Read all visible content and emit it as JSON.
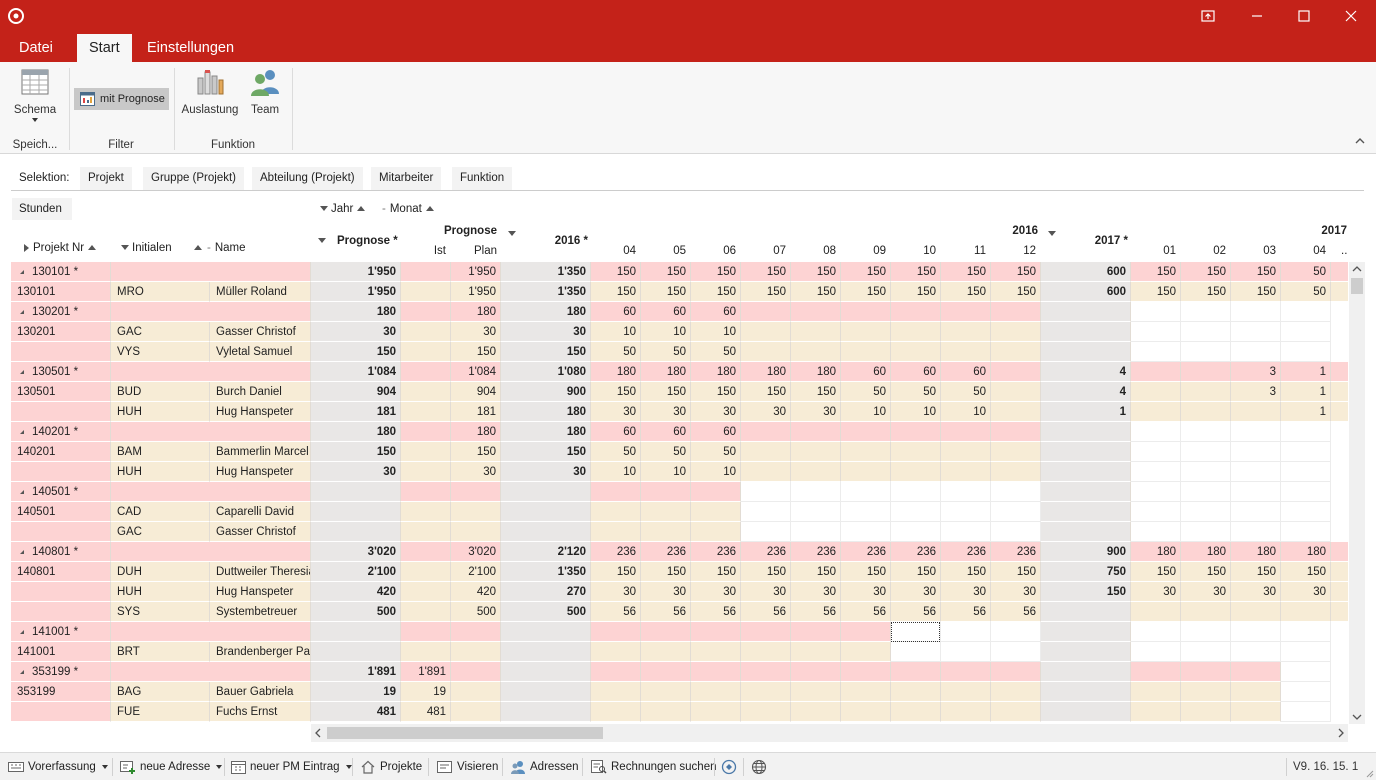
{
  "ribbon": {
    "tabs": [
      "Datei",
      "Start",
      "Einstellungen"
    ],
    "schema_label": "Schema",
    "speich_label": "Speich...",
    "filter_label": "Filter",
    "mit_prognose_label": "mit Prognose",
    "auslastung_label": "Auslastung",
    "team_label": "Team",
    "funktion_label": "Funktion"
  },
  "selection": {
    "label": "Selektion:",
    "items": [
      "Projekt",
      "Gruppe (Projekt)",
      "Abteilung (Projekt)",
      "Mitarbeiter",
      "Funktion"
    ]
  },
  "grid": {
    "data_area": "Stunden",
    "col_dims": [
      "Jahr",
      "Monat"
    ],
    "row_dims": [
      "Projekt Nr",
      "Initialen",
      "Name"
    ],
    "headers": {
      "prognose_star": "Prognose *",
      "prognose": "Prognose",
      "ist": "Ist",
      "plan": "Plan",
      "y2016_total": "2016 *",
      "y2016": "2016",
      "y2017_total": "2017 *",
      "y2017": "2017",
      "months_2016": [
        "04",
        "05",
        "06",
        "07",
        "08",
        "09",
        "10",
        "11",
        "12"
      ],
      "months_2017": [
        "01",
        "02",
        "03",
        "04"
      ],
      "cutoff": ".."
    },
    "rows": [
      {
        "proj": "130101 *",
        "group": true,
        "prog": "1'950",
        "ist": "",
        "plan": "1'950",
        "t16": "1'350",
        "m16": [
          "150",
          "150",
          "150",
          "150",
          "150",
          "150",
          "150",
          "150",
          "150"
        ],
        "t17": "600",
        "m17": [
          "150",
          "150",
          "150",
          "50"
        ],
        "f16": 9,
        "f17": 4
      },
      {
        "proj": "130101",
        "ini": "MRO",
        "name": "Müller Roland",
        "prog": "1'950",
        "ist": "",
        "plan": "1'950",
        "t16": "1'350",
        "m16": [
          "150",
          "150",
          "150",
          "150",
          "150",
          "150",
          "150",
          "150",
          "150"
        ],
        "t17": "600",
        "m17": [
          "150",
          "150",
          "150",
          "50"
        ],
        "f16": 9,
        "f17": 4
      },
      {
        "proj": "130201 *",
        "group": true,
        "prog": "180",
        "ist": "",
        "plan": "180",
        "t16": "180",
        "m16": [
          "60",
          "60",
          "60",
          "",
          "",
          "",
          "",
          "",
          ""
        ],
        "t17": "",
        "m17": [
          "",
          "",
          "",
          ""
        ],
        "f16": 9,
        "f17": 0
      },
      {
        "proj": "130201",
        "ini": "GAC",
        "name": "Gasser Christof",
        "prog": "30",
        "ist": "",
        "plan": "30",
        "t16": "30",
        "m16": [
          "10",
          "10",
          "10",
          "",
          "",
          "",
          "",
          "",
          ""
        ],
        "t17": "",
        "m17": [
          "",
          "",
          "",
          ""
        ],
        "f16": 9,
        "f17": 0
      },
      {
        "proj": "",
        "ini": "VYS",
        "name": "Vyletal Samuel",
        "prog": "150",
        "ist": "",
        "plan": "150",
        "t16": "150",
        "m16": [
          "50",
          "50",
          "50",
          "",
          "",
          "",
          "",
          "",
          ""
        ],
        "t17": "",
        "m17": [
          "",
          "",
          "",
          ""
        ],
        "f16": 9,
        "f17": 0
      },
      {
        "proj": "130501 *",
        "group": true,
        "prog": "1'084",
        "ist": "",
        "plan": "1'084",
        "t16": "1'080",
        "m16": [
          "180",
          "180",
          "180",
          "180",
          "180",
          "60",
          "60",
          "60",
          ""
        ],
        "t17": "4",
        "m17": [
          "",
          "",
          "3",
          "1"
        ],
        "f16": 9,
        "f17": 4
      },
      {
        "proj": "130501",
        "ini": "BUD",
        "name": "Burch Daniel",
        "prog": "904",
        "ist": "",
        "plan": "904",
        "t16": "900",
        "m16": [
          "150",
          "150",
          "150",
          "150",
          "150",
          "50",
          "50",
          "50",
          ""
        ],
        "t17": "4",
        "m17": [
          "",
          "",
          "3",
          "1"
        ],
        "f16": 9,
        "f17": 4
      },
      {
        "proj": "",
        "ini": "HUH",
        "name": "Hug Hanspeter",
        "prog": "181",
        "ist": "",
        "plan": "181",
        "t16": "180",
        "m16": [
          "30",
          "30",
          "30",
          "30",
          "30",
          "10",
          "10",
          "10",
          ""
        ],
        "t17": "1",
        "m17": [
          "",
          "",
          "",
          "1"
        ],
        "f16": 9,
        "f17": 4
      },
      {
        "proj": "140201 *",
        "group": true,
        "prog": "180",
        "ist": "",
        "plan": "180",
        "t16": "180",
        "m16": [
          "60",
          "60",
          "60",
          "",
          "",
          "",
          "",
          "",
          ""
        ],
        "t17": "",
        "m17": [
          "",
          "",
          "",
          ""
        ],
        "f16": 9,
        "f17": 0
      },
      {
        "proj": "140201",
        "ini": "BAM",
        "name": "Bammerlin Marcel",
        "prog": "150",
        "ist": "",
        "plan": "150",
        "t16": "150",
        "m16": [
          "50",
          "50",
          "50",
          "",
          "",
          "",
          "",
          "",
          ""
        ],
        "t17": "",
        "m17": [
          "",
          "",
          "",
          ""
        ],
        "f16": 9,
        "f17": 0
      },
      {
        "proj": "",
        "ini": "HUH",
        "name": "Hug Hanspeter",
        "prog": "30",
        "ist": "",
        "plan": "30",
        "t16": "30",
        "m16": [
          "10",
          "10",
          "10",
          "",
          "",
          "",
          "",
          "",
          ""
        ],
        "t17": "",
        "m17": [
          "",
          "",
          "",
          ""
        ],
        "f16": 9,
        "f17": 0
      },
      {
        "proj": "140501 *",
        "group": true,
        "prog": "",
        "ist": "",
        "plan": "",
        "t16": "",
        "m16": [
          "",
          "",
          "",
          "",
          "",
          "",
          "",
          "",
          ""
        ],
        "t17": "",
        "m17": [
          "",
          "",
          "",
          ""
        ],
        "f16": 3,
        "f17": 0
      },
      {
        "proj": "140501",
        "ini": "CAD",
        "name": "Caparelli David",
        "prog": "",
        "ist": "",
        "plan": "",
        "t16": "",
        "m16": [
          "",
          "",
          "",
          "",
          "",
          "",
          "",
          "",
          ""
        ],
        "t17": "",
        "m17": [
          "",
          "",
          "",
          ""
        ],
        "f16": 3,
        "f17": 0
      },
      {
        "proj": "",
        "ini": "GAC",
        "name": "Gasser Christof",
        "prog": "",
        "ist": "",
        "plan": "",
        "t16": "",
        "m16": [
          "",
          "",
          "",
          "",
          "",
          "",
          "",
          "",
          ""
        ],
        "t17": "",
        "m17": [
          "",
          "",
          "",
          ""
        ],
        "f16": 3,
        "f17": 0
      },
      {
        "proj": "140801 *",
        "group": true,
        "prog": "3'020",
        "ist": "",
        "plan": "3'020",
        "t16": "2'120",
        "m16": [
          "236",
          "236",
          "236",
          "236",
          "236",
          "236",
          "236",
          "236",
          "236"
        ],
        "t17": "900",
        "m17": [
          "180",
          "180",
          "180",
          "180"
        ],
        "f16": 9,
        "f17": 4
      },
      {
        "proj": "140801",
        "ini": "DUH",
        "name": "Duttweiler Theresia",
        "prog": "2'100",
        "ist": "",
        "plan": "2'100",
        "t16": "1'350",
        "m16": [
          "150",
          "150",
          "150",
          "150",
          "150",
          "150",
          "150",
          "150",
          "150"
        ],
        "t17": "750",
        "m17": [
          "150",
          "150",
          "150",
          "150"
        ],
        "f16": 9,
        "f17": 4
      },
      {
        "proj": "",
        "ini": "HUH",
        "name": "Hug Hanspeter",
        "prog": "420",
        "ist": "",
        "plan": "420",
        "t16": "270",
        "m16": [
          "30",
          "30",
          "30",
          "30",
          "30",
          "30",
          "30",
          "30",
          "30"
        ],
        "t17": "150",
        "m17": [
          "30",
          "30",
          "30",
          "30"
        ],
        "f16": 9,
        "f17": 4
      },
      {
        "proj": "",
        "ini": "SYS",
        "name": "Systembetreuer",
        "prog": "500",
        "ist": "",
        "plan": "500",
        "t16": "500",
        "m16": [
          "56",
          "56",
          "56",
          "56",
          "56",
          "56",
          "56",
          "56",
          "56"
        ],
        "t17": "",
        "m17": [
          "",
          "",
          "",
          ""
        ],
        "f16": 9,
        "f17": 4
      },
      {
        "proj": "141001 *",
        "group": true,
        "prog": "",
        "ist": "",
        "plan": "",
        "t16": "",
        "m16": [
          "",
          "",
          "",
          "",
          "",
          "",
          "",
          "",
          ""
        ],
        "t17": "",
        "m17": [
          "",
          "",
          "",
          ""
        ],
        "f16": 6,
        "f17": 0
      },
      {
        "proj": "141001",
        "ini": "BRT",
        "name": "Brandenberger Pati",
        "prog": "",
        "ist": "",
        "plan": "",
        "t16": "",
        "m16": [
          "",
          "",
          "",
          "",
          "",
          "",
          "",
          "",
          ""
        ],
        "t17": "",
        "m17": [
          "",
          "",
          "",
          ""
        ],
        "f16": 6,
        "f17": 0
      },
      {
        "proj": "353199 *",
        "group": true,
        "prog": "1'891",
        "ist": "1'891",
        "plan": "",
        "t16": "",
        "m16": [
          "",
          "",
          "",
          "",
          "",
          "",
          "",
          "",
          ""
        ],
        "t17": "",
        "m17": [
          "",
          "",
          "",
          ""
        ],
        "f16": 9,
        "f17": 3
      },
      {
        "proj": "353199",
        "ini": "BAG",
        "name": "Bauer Gabriela",
        "prog": "19",
        "ist": "19",
        "plan": "",
        "t16": "",
        "m16": [
          "",
          "",
          "",
          "",
          "",
          "",
          "",
          "",
          ""
        ],
        "t17": "",
        "m17": [
          "",
          "",
          "",
          ""
        ],
        "f16": 9,
        "f17": 3
      },
      {
        "proj": "",
        "ini": "FUE",
        "name": "Fuchs Ernst",
        "prog": "481",
        "ist": "481",
        "plan": "",
        "t16": "",
        "m16": [
          "",
          "",
          "",
          "",
          "",
          "",
          "",
          "",
          ""
        ],
        "t17": "",
        "m17": [
          "",
          "",
          "",
          ""
        ],
        "f16": 9,
        "f17": 3
      }
    ]
  },
  "statusbar": {
    "items": [
      "Vorerfassung",
      "neue Adresse",
      "neuer PM Eintrag",
      "Projekte",
      "Visieren",
      "Adressen",
      "Rechnungen suchen"
    ],
    "version": "V9. 16. 15. 1"
  },
  "colors": {
    "brand_red": "#c42219",
    "group_row": "#fdd3d3",
    "detail_row": "#f7ecd6",
    "total_col": "#e9e7e6",
    "empty_cell": "#ffffff"
  }
}
